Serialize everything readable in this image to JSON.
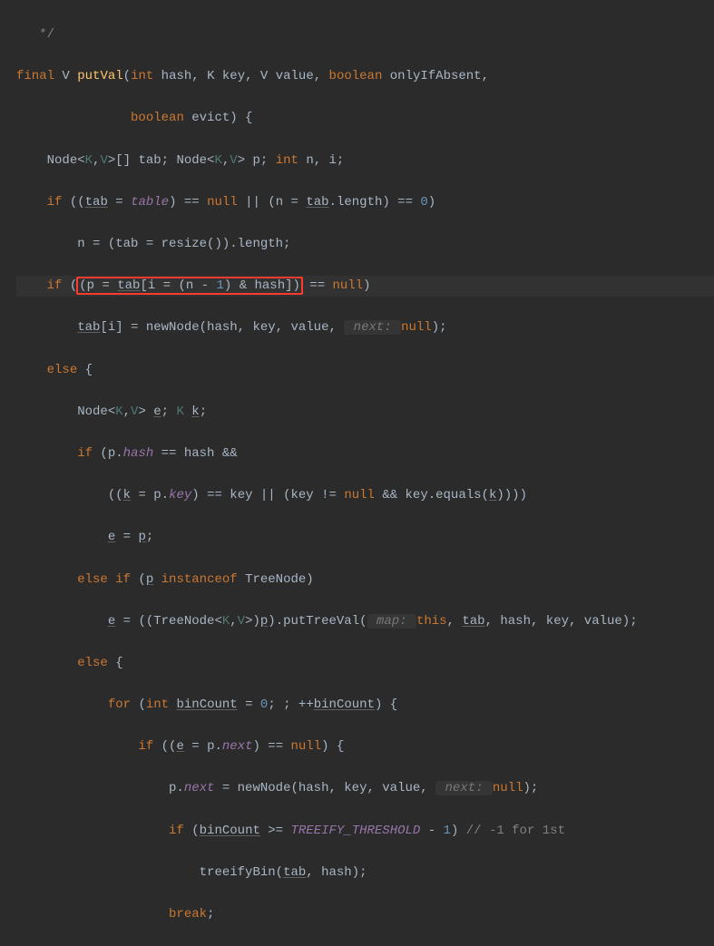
{
  "code": {
    "l0": {
      "t0": "*/"
    },
    "l1": {
      "kw1": "final",
      "type1": " V ",
      "meth": "putVal",
      "paren1": "(",
      "kw2": "int",
      "p1": " hash, ",
      "type2": "K",
      "p2": " key, ",
      "type3": "V",
      "p3": " value, ",
      "kw3": "boolean",
      "p4": " onlyIfAbsent,"
    },
    "l2": {
      "kw1": "boolean",
      "p1": " evict) {"
    },
    "l3": {
      "t1": "Node<",
      "gp": "K",
      "c": ",",
      "gp2": "V",
      "t2": ">[] tab; Node<",
      "gp3": "K",
      "c2": ",",
      "gp4": "V",
      "t3": "> p; ",
      "kw1": "int",
      "t4": " n, i;"
    },
    "l4": {
      "kw1": "if",
      "t1": " ((",
      "u1": "tab",
      "t2": " = ",
      "f1": "table",
      "t3": ") == ",
      "kw2": "null",
      "t4": " || (n = ",
      "u2": "tab",
      "t5": ".length) == ",
      "n1": "0",
      "t6": ")"
    },
    "l5": {
      "t1": "n = (tab = resize()).length;"
    },
    "l6": {
      "kw1": "if",
      "t1": " (",
      "box": "(p = ",
      "u1": "tab",
      "box2": "[i = (n - ",
      "n1": "1",
      "box3": ") & hash])",
      "t2": " == ",
      "kw2": "null",
      "t3": ")"
    },
    "l7": {
      "u1": "tab",
      "t1": "[i] = newNode(hash, key, value, ",
      "hint": " next: ",
      "kw1": "null",
      "t2": ");"
    },
    "l8": {
      "kw1": "else",
      "t1": " {"
    },
    "l9": {
      "t1": "Node<",
      "gp": "K",
      "c": ",",
      "gp2": "V",
      "t2": "> ",
      "u1": "e",
      "t3": "; ",
      "gp3": "K",
      "t4": " ",
      "u2": "k",
      "t5": ";"
    },
    "l10": {
      "kw1": "if",
      "t1": " (p.",
      "f1": "hash",
      "t2": " == hash &&"
    },
    "l11": {
      "t1": "((",
      "u1": "k",
      "t2": " = p.",
      "f1": "key",
      "t3": ") == key || (key != ",
      "kw1": "null",
      "t4": " && key.equals(",
      "u2": "k",
      "t5": "))))"
    },
    "l12": {
      "u1": "e",
      "t1": " = ",
      "u2": "p",
      "t2": ";"
    },
    "l13": {
      "kw1": "else if",
      "t1": " (",
      "u1": "p",
      "t2": " ",
      "kw2": "instanceof",
      "t3": " TreeNode)"
    },
    "l14": {
      "u1": "e",
      "t1": " = ((TreeNode<",
      "gp": "K",
      "c": ",",
      "gp2": "V",
      "t2": ">)",
      "u2": "p",
      "t3": ").putTreeVal(",
      "hint": " map: ",
      "kw1": "this",
      "t4": ", ",
      "u3": "tab",
      "t5": ", hash, key, value);"
    },
    "l15": {
      "kw1": "else",
      "t1": " {"
    },
    "l16": {
      "kw1": "for",
      "t1": " (",
      "kw2": "int",
      "t2": " ",
      "u1": "binCount",
      "t3": " = ",
      "n1": "0",
      "t4": "; ; ++",
      "u2": "binCount",
      "t5": ") {"
    },
    "l17": {
      "kw1": "if",
      "t1": " ((",
      "u1": "e",
      "t2": " = p.",
      "f1": "next",
      "t3": ") == ",
      "kw2": "null",
      "t4": ") {"
    },
    "l18": {
      "t1": "p.",
      "f1": "next",
      "t2": " = newNode(hash, key, value, ",
      "hint": " next: ",
      "kw1": "null",
      "t3": ");"
    },
    "l19": {
      "kw1": "if",
      "t1": " (",
      "u1": "binCount",
      "t2": " >= ",
      "c1": "TREEIFY_THRESHOLD",
      "t3": " - ",
      "n1": "1",
      "t4": ") ",
      "cm": "// -1 for 1st"
    },
    "l20": {
      "t1": "treeifyBin(",
      "u1": "tab",
      "t2": ", hash);"
    },
    "l21": {
      "kw1": "break",
      "t1": ";"
    }
  }
}
